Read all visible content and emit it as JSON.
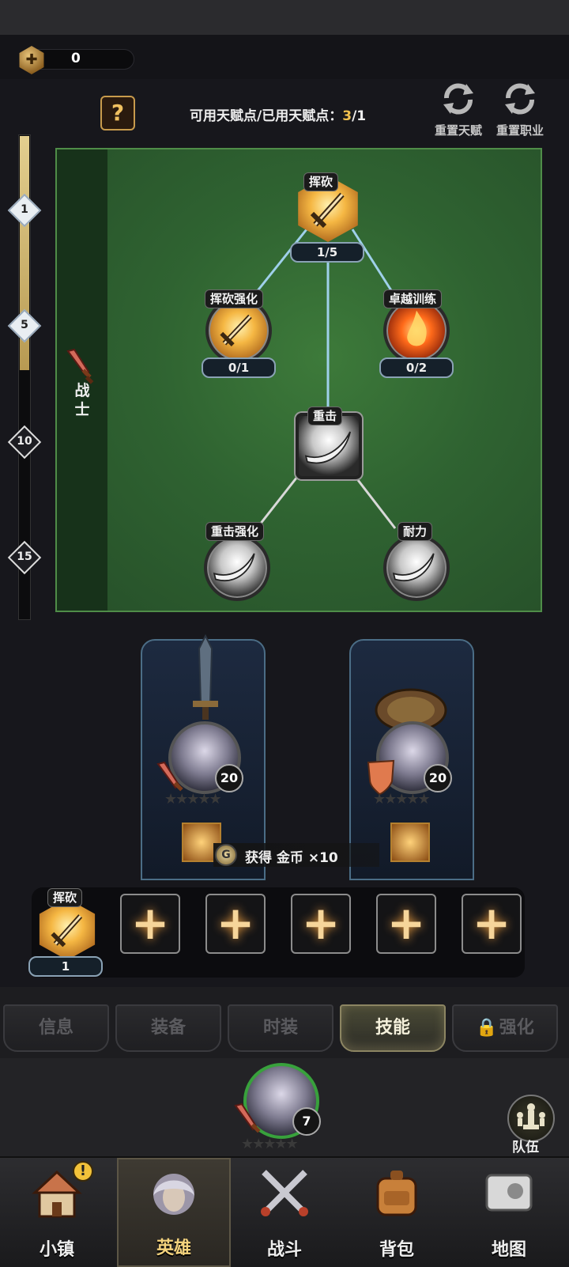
{
  "currency": {
    "value": "0",
    "icon": "currency-gem-icon"
  },
  "talent": {
    "help_label": "?",
    "points_prefix": "可用天赋点/已用天赋点：",
    "points_available": "3",
    "points_sep": "/",
    "points_used": "1",
    "reset_talent_label": "重置天赋",
    "reset_class_label": "重置职业"
  },
  "level_markers": [
    "1",
    "5",
    "10",
    "15"
  ],
  "level_progress": 0.5,
  "class": {
    "label": "战士",
    "icon": "warrior-sword-icon"
  },
  "nodes": {
    "slash": {
      "name": "挥砍",
      "count": "1/5"
    },
    "slash_plus": {
      "name": "挥砍强化",
      "count": "0/1"
    },
    "training": {
      "name": "卓越训练",
      "count": "0/2"
    },
    "heavy": {
      "name": "重击"
    },
    "heavy_plus": {
      "name": "重击强化"
    },
    "endurance": {
      "name": "耐力"
    }
  },
  "heroes": [
    {
      "level": "20",
      "stars": "★★★★★",
      "weapon": "sword-icon",
      "offhand": "sword-icon"
    },
    {
      "level": "20",
      "stars": "★★★★★",
      "weapon": "shield-icon",
      "offhand": "shield-icon"
    }
  ],
  "toast": {
    "coin": "G",
    "text": "获得 金币 ×10"
  },
  "skill_slots": {
    "active": {
      "name": "挥砍",
      "count": "1"
    },
    "empty_symbol": "+"
  },
  "tabs": [
    {
      "label": "信息"
    },
    {
      "label": "装备"
    },
    {
      "label": "时装"
    },
    {
      "label": "技能"
    },
    {
      "label": "强化"
    }
  ],
  "selected_hero": {
    "level": "7",
    "stars": "★★★★★"
  },
  "team": {
    "label": "队伍"
  },
  "nav": [
    {
      "label": "小镇",
      "alert": "!"
    },
    {
      "label": "英雄"
    },
    {
      "label": "战斗"
    },
    {
      "label": "背包"
    },
    {
      "label": "地图"
    }
  ]
}
